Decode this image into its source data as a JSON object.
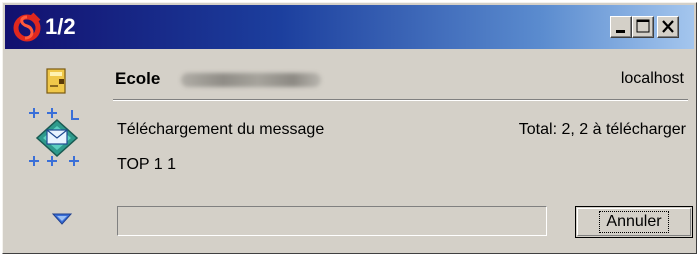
{
  "window": {
    "title": "1/2",
    "controls": {
      "minimize_icon": "minimize-icon",
      "maximize_icon": "maximize-icon",
      "close_icon": "close-icon"
    }
  },
  "account": {
    "label": "Ecole",
    "host": "localhost"
  },
  "transfer": {
    "status": "Téléchargement du message",
    "totals": "Total: 2,  2 à télécharger",
    "command": "TOP 1 1",
    "progress": 0
  },
  "actions": {
    "cancel_label": "Annuler"
  },
  "colors": {
    "titlebar_start": "#12106f",
    "titlebar_end": "#a4c6ee",
    "window_bg": "#d4d0c8"
  }
}
